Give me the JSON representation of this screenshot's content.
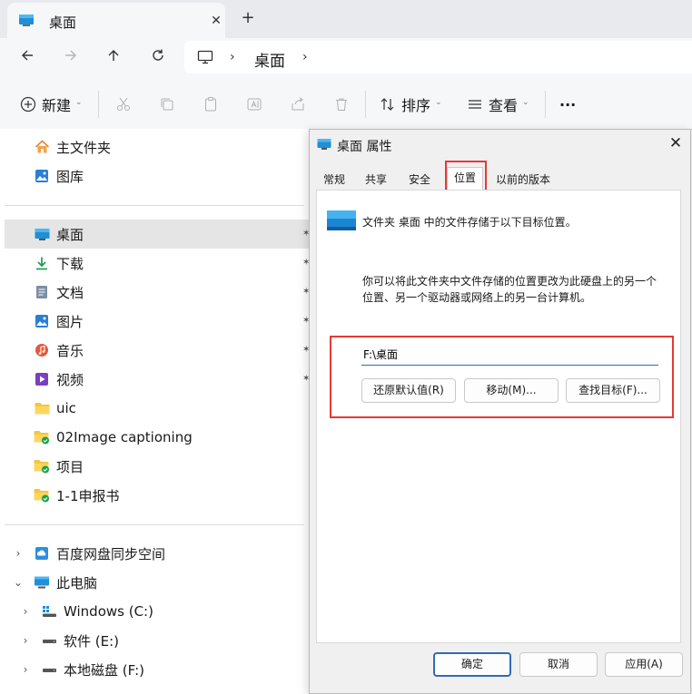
{
  "tab": {
    "title": "桌面",
    "close": "✕",
    "new_tab": "+"
  },
  "address": {
    "breadcrumb": [
      "桌面"
    ]
  },
  "toolbar": {
    "new_label": "新建",
    "sort_label": "排序",
    "view_label": "查看",
    "more_label": "···"
  },
  "sidebar": {
    "quick": [
      {
        "label": "主文件夹",
        "icon": "home-icon"
      },
      {
        "label": "图库",
        "icon": "gallery-icon"
      }
    ],
    "pinned": [
      {
        "label": "桌面",
        "icon": "desktop-icon",
        "selected": true
      },
      {
        "label": "下载",
        "icon": "download-icon"
      },
      {
        "label": "文档",
        "icon": "document-icon"
      },
      {
        "label": "图片",
        "icon": "pictures-icon"
      },
      {
        "label": "音乐",
        "icon": "music-icon"
      },
      {
        "label": "视频",
        "icon": "video-icon"
      },
      {
        "label": "uic",
        "icon": "folder-icon"
      },
      {
        "label": "02Image captioning",
        "icon": "synced-folder-icon"
      },
      {
        "label": "项目",
        "icon": "synced-folder-icon"
      },
      {
        "label": "1-1申报书",
        "icon": "synced-folder-icon"
      }
    ],
    "tree": [
      {
        "label": "百度网盘同步空间",
        "icon": "cloud-sync-icon",
        "expander": "›"
      },
      {
        "label": "此电脑",
        "icon": "computer-icon",
        "expander": "⌄"
      },
      {
        "label": "Windows (C:)",
        "icon": "windows-drive-icon",
        "expander": "›"
      },
      {
        "label": "软件 (E:)",
        "icon": "drive-icon",
        "expander": "›"
      },
      {
        "label": "本地磁盘 (F:)",
        "icon": "drive-icon",
        "expander": "›"
      }
    ]
  },
  "dialog": {
    "title": "桌面 属性",
    "close": "✕",
    "tabs": [
      "常规",
      "共享",
      "安全",
      "位置",
      "以前的版本"
    ],
    "active_tab": "位置",
    "description": "文件夹 桌面 中的文件存储于以下目标位置。",
    "hint_line1": "你可以将此文件夹中文件存储的位置更改为此硬盘上的另一个",
    "hint_line2": "位置、另一个驱动器或网络上的另一台计算机。",
    "path_value": "F:\\桌面",
    "restore_button": "还原默认值(R)",
    "move_button": "移动(M)...",
    "find_target_button": "查找目标(F)...",
    "ok_button": "确定",
    "cancel_button": "取消",
    "apply_button": "应用(A)"
  },
  "colors": {
    "accent": "#2f6bb8",
    "highlight_box": "#e53935",
    "selected_bg": "#e5e5e5"
  }
}
